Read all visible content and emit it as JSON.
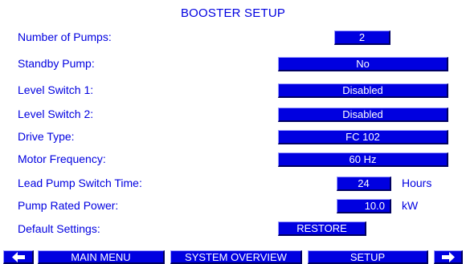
{
  "title": "BOOSTER SETUP",
  "settings": {
    "number_of_pumps": {
      "label": "Number of Pumps:",
      "value": "2"
    },
    "standby_pump": {
      "label": "Standby Pump:",
      "value": "No"
    },
    "level_switch_1": {
      "label": "Level Switch 1:",
      "value": "Disabled"
    },
    "level_switch_2": {
      "label": "Level Switch 2:",
      "value": "Disabled"
    },
    "drive_type": {
      "label": "Drive Type:",
      "value": "FC 102"
    },
    "motor_frequency": {
      "label": "Motor Frequency:",
      "value": "60 Hz"
    },
    "lead_pump_switch_time": {
      "label": "Lead Pump Switch Time:",
      "value": "24",
      "unit": "Hours"
    },
    "pump_rated_power": {
      "label": "Pump Rated Power:",
      "value": "10.0",
      "unit": "kW"
    },
    "default_settings": {
      "label": "Default Settings:",
      "button": "RESTORE"
    }
  },
  "nav": {
    "prev_icon": "arrow-left-icon",
    "main_menu": "MAIN MENU",
    "system_overview": "SYSTEM OVERVIEW",
    "setup": "SETUP",
    "next_icon": "arrow-right-icon"
  },
  "colors": {
    "accent": "#0000e0",
    "button_text": "#ffffff",
    "background": "#ffffff"
  }
}
